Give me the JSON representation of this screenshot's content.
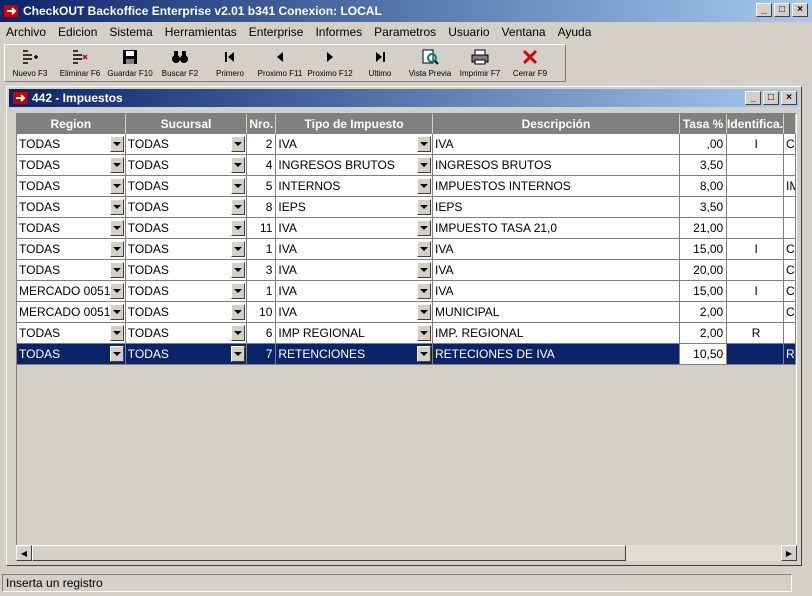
{
  "app": {
    "title": "CheckOUT Backoffice Enterprise v2.01 b341 Conexion: LOCAL"
  },
  "menu": [
    "Archivo",
    "Edicion",
    "Sistema",
    "Herramientas",
    "Enterprise",
    "Informes",
    "Parametros",
    "Usuario",
    "Ventana",
    "Ayuda"
  ],
  "toolbar": [
    {
      "label": "Nuevo F3",
      "icon": "new-icon"
    },
    {
      "label": "Eliminar F6",
      "icon": "delete-icon"
    },
    {
      "label": "Guardar F10",
      "icon": "save-icon"
    },
    {
      "label": "Buscar F2",
      "icon": "binoculars-icon"
    },
    {
      "label": "Primero",
      "icon": "first-icon"
    },
    {
      "label": "Proximo F11",
      "icon": "prev-icon"
    },
    {
      "label": "Proximo F12",
      "icon": "next-icon"
    },
    {
      "label": "Ultimo",
      "icon": "last-icon"
    },
    {
      "label": "Vista Previa",
      "icon": "preview-icon"
    },
    {
      "label": "Imprimir F7",
      "icon": "print-icon"
    },
    {
      "label": "Cerrar F9",
      "icon": "close-icon"
    }
  ],
  "child_window": {
    "title": "442 - Impuestos"
  },
  "grid": {
    "columns": [
      "Region",
      "Sucursal",
      "Nro.",
      "Tipo de Impuesto",
      "Descripción",
      "Tasa %",
      "Identifica.",
      ""
    ],
    "rows": [
      {
        "region": "TODAS",
        "sucursal": "TODAS",
        "nro": "2",
        "tipo": "IVA",
        "desc": "IVA",
        "tasa": ",00",
        "ident": "I",
        "extra": "C"
      },
      {
        "region": "TODAS",
        "sucursal": "TODAS",
        "nro": "4",
        "tipo": "INGRESOS BRUTOS",
        "desc": "INGRESOS BRUTOS",
        "tasa": "3,50",
        "ident": "",
        "extra": ""
      },
      {
        "region": "TODAS",
        "sucursal": "TODAS",
        "nro": "5",
        "tipo": "INTERNOS",
        "desc": "IMPUESTOS INTERNOS",
        "tasa": "8,00",
        "ident": "",
        "extra": "IM"
      },
      {
        "region": "TODAS",
        "sucursal": "TODAS",
        "nro": "8",
        "tipo": "IEPS",
        "desc": " IEPS",
        "tasa": "3,50",
        "ident": "",
        "extra": ""
      },
      {
        "region": "TODAS",
        "sucursal": "TODAS",
        "nro": "11",
        "tipo": "IVA",
        "desc": "IMPUESTO TASA 21,0",
        "tasa": "21,00",
        "ident": "",
        "extra": ""
      },
      {
        "region": "TODAS",
        "sucursal": "TODAS",
        "nro": "1",
        "tipo": "IVA",
        "desc": "IVA",
        "tasa": "15,00",
        "ident": "I",
        "extra": "C"
      },
      {
        "region": "TODAS",
        "sucursal": "TODAS",
        "nro": "3",
        "tipo": "IVA",
        "desc": "IVA",
        "tasa": "20,00",
        "ident": "",
        "extra": "C"
      },
      {
        "region": "MERCADO 0051",
        "sucursal": "TODAS",
        "nro": "1",
        "tipo": "IVA",
        "desc": "IVA",
        "tasa": "15,00",
        "ident": "I",
        "extra": "C"
      },
      {
        "region": "MERCADO 0051",
        "sucursal": "TODAS",
        "nro": "10",
        "tipo": "IVA",
        "desc": "MUNICIPAL",
        "tasa": "2,00",
        "ident": "",
        "extra": "C"
      },
      {
        "region": "TODAS",
        "sucursal": "TODAS",
        "nro": "6",
        "tipo": "IMP REGIONAL",
        "desc": "IMP. REGIONAL",
        "tasa": "2,00",
        "ident": "R",
        "extra": ""
      },
      {
        "region": "TODAS",
        "sucursal": "TODAS",
        "nro": "7",
        "tipo": "RETENCIONES",
        "desc": "RETECIONES DE IVA",
        "tasa": "10,50",
        "ident": "",
        "extra": "R",
        "selected": true
      }
    ]
  },
  "status": {
    "text": "Inserta un registro"
  }
}
